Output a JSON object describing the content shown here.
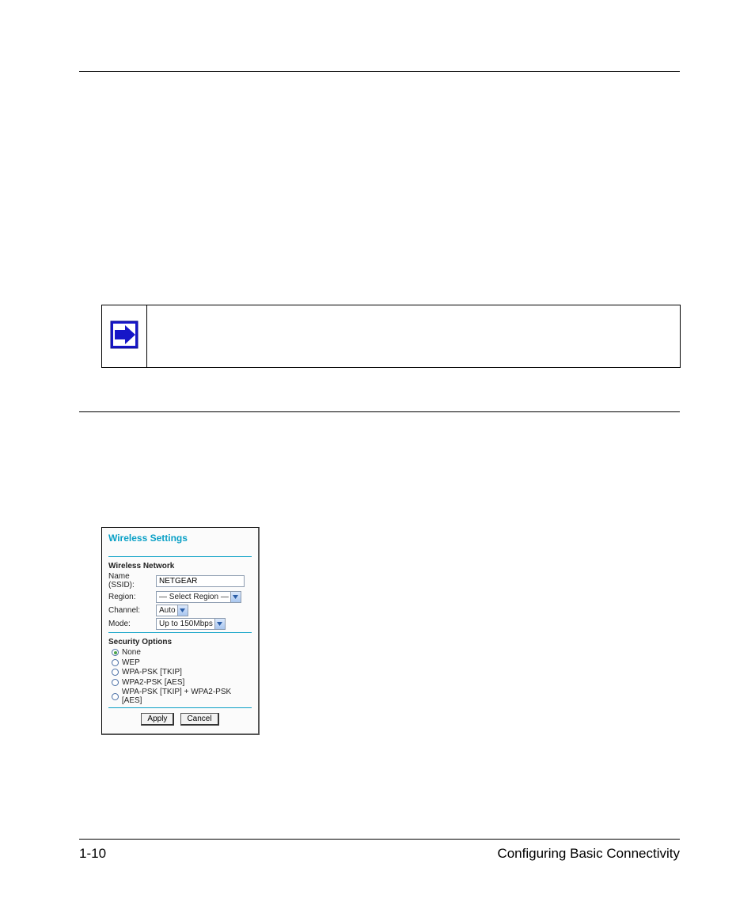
{
  "footer": {
    "page": "1-10",
    "section": "Configuring Basic Connectivity"
  },
  "wireless": {
    "title": "Wireless Settings",
    "network_section": "Wireless Network",
    "security_section": "Security Options",
    "fields": {
      "name_label": "Name (SSID):",
      "name_value": "NETGEAR",
      "region_label": "Region:",
      "region_value": "— Select Region —",
      "channel_label": "Channel:",
      "channel_value": "Auto",
      "mode_label": "Mode:",
      "mode_value": "Up to 150Mbps"
    },
    "security_options": [
      "None",
      "WEP",
      "WPA-PSK [TKIP]",
      "WPA2-PSK [AES]",
      "WPA-PSK [TKIP] + WPA2-PSK [AES]"
    ],
    "selected_security_index": 0,
    "buttons": {
      "apply": "Apply",
      "cancel": "Cancel"
    }
  }
}
